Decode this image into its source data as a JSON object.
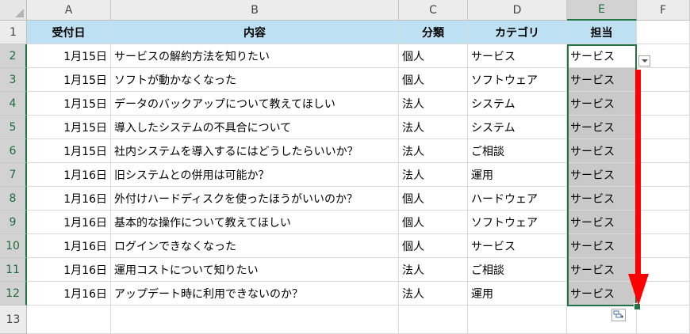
{
  "columns": [
    "A",
    "B",
    "C",
    "D",
    "E",
    "F"
  ],
  "rows": [
    "1",
    "2",
    "3",
    "4",
    "5",
    "6",
    "7",
    "8",
    "9",
    "10",
    "11",
    "12",
    "13"
  ],
  "header": {
    "a": "受付日",
    "b": "内容",
    "c": "分類",
    "d": "カテゴリ",
    "e": "担当"
  },
  "data": [
    {
      "date": "1月15日",
      "content": "サービスの解約方法を知りたい",
      "cls": "個人",
      "cat": "サービス",
      "owner": "サービス"
    },
    {
      "date": "1月15日",
      "content": "ソフトが動かなくなった",
      "cls": "個人",
      "cat": "ソフトウェア",
      "owner": "サービス"
    },
    {
      "date": "1月15日",
      "content": "データのバックアップについて教えてほしい",
      "cls": "法人",
      "cat": "システム",
      "owner": "サービス"
    },
    {
      "date": "1月15日",
      "content": "導入したシステムの不具合について",
      "cls": "法人",
      "cat": "システム",
      "owner": "サービス"
    },
    {
      "date": "1月15日",
      "content": "社内システムを導入するにはどうしたらいいか？",
      "cls": "法人",
      "cat": "ご相談",
      "owner": "サービス"
    },
    {
      "date": "1月16日",
      "content": "旧システムとの併用は可能か？",
      "cls": "法人",
      "cat": "運用",
      "owner": "サービス"
    },
    {
      "date": "1月16日",
      "content": "外付けハードディスクを使ったほうがいいのか？",
      "cls": "個人",
      "cat": "ハードウェア",
      "owner": "サービス"
    },
    {
      "date": "1月16日",
      "content": "基本的な操作について教えてほしい",
      "cls": "個人",
      "cat": "ソフトウェア",
      "owner": "サービス"
    },
    {
      "date": "1月16日",
      "content": "ログインできなくなった",
      "cls": "個人",
      "cat": "サービス",
      "owner": "サービス"
    },
    {
      "date": "1月16日",
      "content": "運用コストについて知りたい",
      "cls": "法人",
      "cat": "ご相談",
      "owner": "サービス"
    },
    {
      "date": "1月16日",
      "content": "アップデート時に利用できないのか？",
      "cls": "法人",
      "cat": "運用",
      "owner": "サービス"
    }
  ],
  "icons": {
    "dropdown": "dropdown-arrow-icon",
    "autofill": "autofill-options-icon",
    "arrow": "red-down-arrow-icon"
  },
  "colors": {
    "header_fill": "#bde0f2",
    "selection": "#217346",
    "fill_range": "#c9c9c9",
    "arrow": "#ff0000"
  }
}
